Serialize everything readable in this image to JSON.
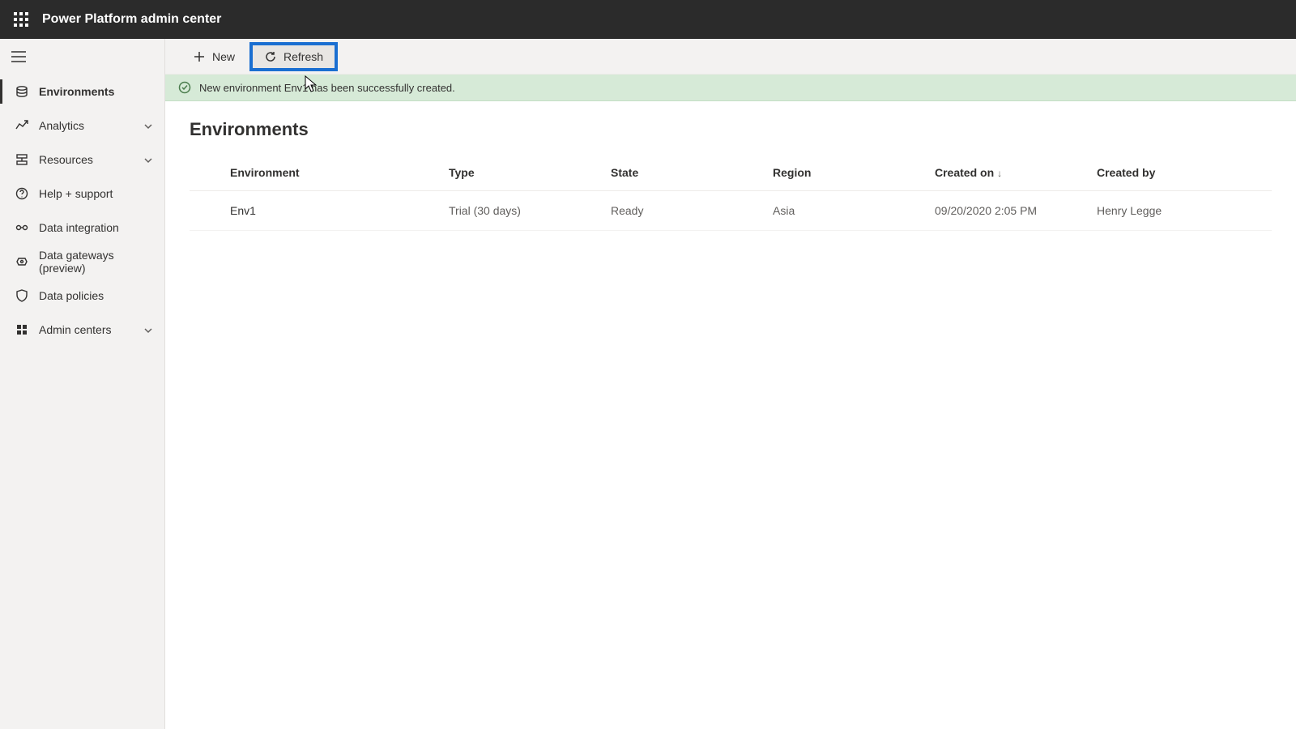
{
  "header": {
    "app_title": "Power Platform admin center"
  },
  "sidebar": {
    "items": [
      {
        "label": "Environments"
      },
      {
        "label": "Analytics"
      },
      {
        "label": "Resources"
      },
      {
        "label": "Help + support"
      },
      {
        "label": "Data integration"
      },
      {
        "label": "Data gateways (preview)"
      },
      {
        "label": "Data policies"
      },
      {
        "label": "Admin centers"
      }
    ]
  },
  "command_bar": {
    "new_label": "New",
    "refresh_label": "Refresh"
  },
  "notification": {
    "message": "New environment Env1 has been successfully created."
  },
  "page": {
    "title": "Environments"
  },
  "table": {
    "columns": {
      "environment": "Environment",
      "type": "Type",
      "state": "State",
      "region": "Region",
      "created_on": "Created on",
      "created_by": "Created by"
    },
    "sort_indicator": "↓",
    "rows": [
      {
        "environment": "Env1",
        "type": "Trial (30 days)",
        "state": "Ready",
        "region": "Asia",
        "created_on": "09/20/2020 2:05 PM",
        "created_by": "Henry Legge"
      }
    ]
  }
}
